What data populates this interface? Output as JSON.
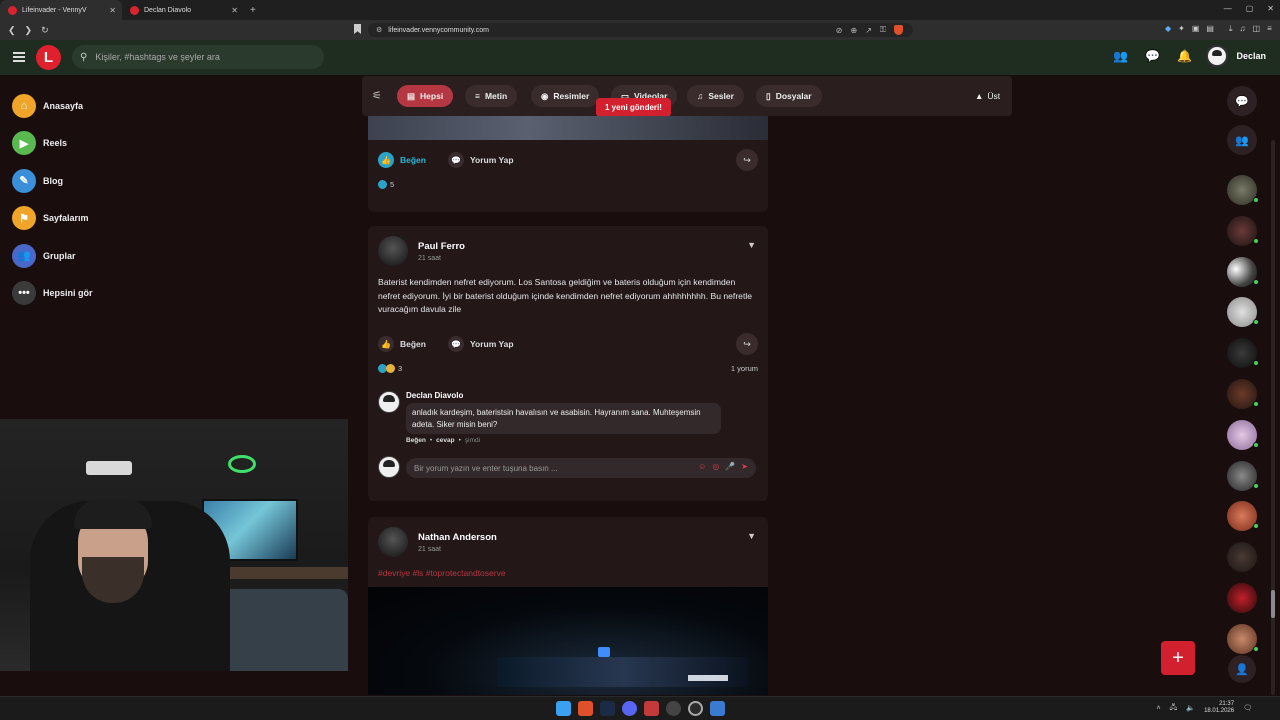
{
  "browser": {
    "tabs": [
      {
        "title": "Lifeinvader - VennyV"
      },
      {
        "title": "Declan Diavolo"
      }
    ],
    "url": "lifeinvader.vennycommunity.com"
  },
  "header": {
    "logo_letter": "L",
    "search_placeholder": "Kişiler, #hashtags ve şeyler ara",
    "username": "Declan"
  },
  "sidebar": {
    "items": [
      {
        "label": "Anasayfa",
        "icon": "home-icon",
        "color": "#f0a52a"
      },
      {
        "label": "Reels",
        "icon": "reels-icon",
        "color": "#59b84f"
      },
      {
        "label": "Blog",
        "icon": "blog-icon",
        "color": "#3a8fd8"
      },
      {
        "label": "Sayfalarım",
        "icon": "flag-icon",
        "color": "#f0a52a"
      },
      {
        "label": "Gruplar",
        "icon": "groups-icon",
        "color": "#4a68c9"
      },
      {
        "label": "Hepsini gör",
        "icon": "more-icon",
        "color": "#3a3a3a"
      }
    ]
  },
  "filters": {
    "items": [
      {
        "label": "Hepsi",
        "icon": "all-icon"
      },
      {
        "label": "Metin",
        "icon": "text-icon"
      },
      {
        "label": "Resimler",
        "icon": "camera-icon"
      },
      {
        "label": "Videolar",
        "icon": "video-icon"
      },
      {
        "label": "Sesler",
        "icon": "music-icon"
      },
      {
        "label": "Dosyalar",
        "icon": "file-icon"
      }
    ],
    "active": "Hepsi",
    "new_posts_label": "1 yeni gönderi!",
    "top_label": "Üst"
  },
  "posts": [
    {
      "like_label": "Beğen",
      "comment_label": "Yorum Yap",
      "reaction_count": "5",
      "liked": true
    },
    {
      "author": "Paul Ferro",
      "time": "21 saat",
      "text": "Baterist kendimden nefret ediyorum. Los Santosa geldiğim ve bateris olduğum için kendimden nefret ediyorum. İyi bir baterist olduğum içinde kendimden nefret ediyorum ahhhhhhhh. Bu nefretle vuracağım davula zile",
      "like_label": "Beğen",
      "comment_label": "Yorum Yap",
      "reaction_count": "3",
      "comment_count": "1 yorum",
      "comments": [
        {
          "author": "Declan Diavolo",
          "text": "anladık kardeşim, bateristsin havalısın ve asabisin. Hayranım sana. Muhteşemsin adeta. Siker misin beni?",
          "like_label": "Beğen",
          "reply_label": "cevap",
          "time": "şimdi"
        }
      ],
      "comment_placeholder": "Bir yorum yazın ve enter tuşuna basın ..."
    },
    {
      "author": "Nathan Anderson",
      "time": "21 saat",
      "tags": "#devriye #ls #toprotectandtoserve"
    }
  ],
  "colors": {
    "accent": "#d2202e",
    "active_filter": "#b53742",
    "liked": "#2ab7d8",
    "online": "#3ed75b"
  },
  "contacts": [
    {
      "online": true
    },
    {
      "online": true
    },
    {
      "online": true
    },
    {
      "online": true
    },
    {
      "online": true
    },
    {
      "online": true
    },
    {
      "online": true
    },
    {
      "online": true
    },
    {
      "online": true
    },
    {
      "online": false
    },
    {
      "online": false
    },
    {
      "online": true
    }
  ],
  "taskbar": {
    "time": "21:37",
    "date": "18.01.2026"
  }
}
